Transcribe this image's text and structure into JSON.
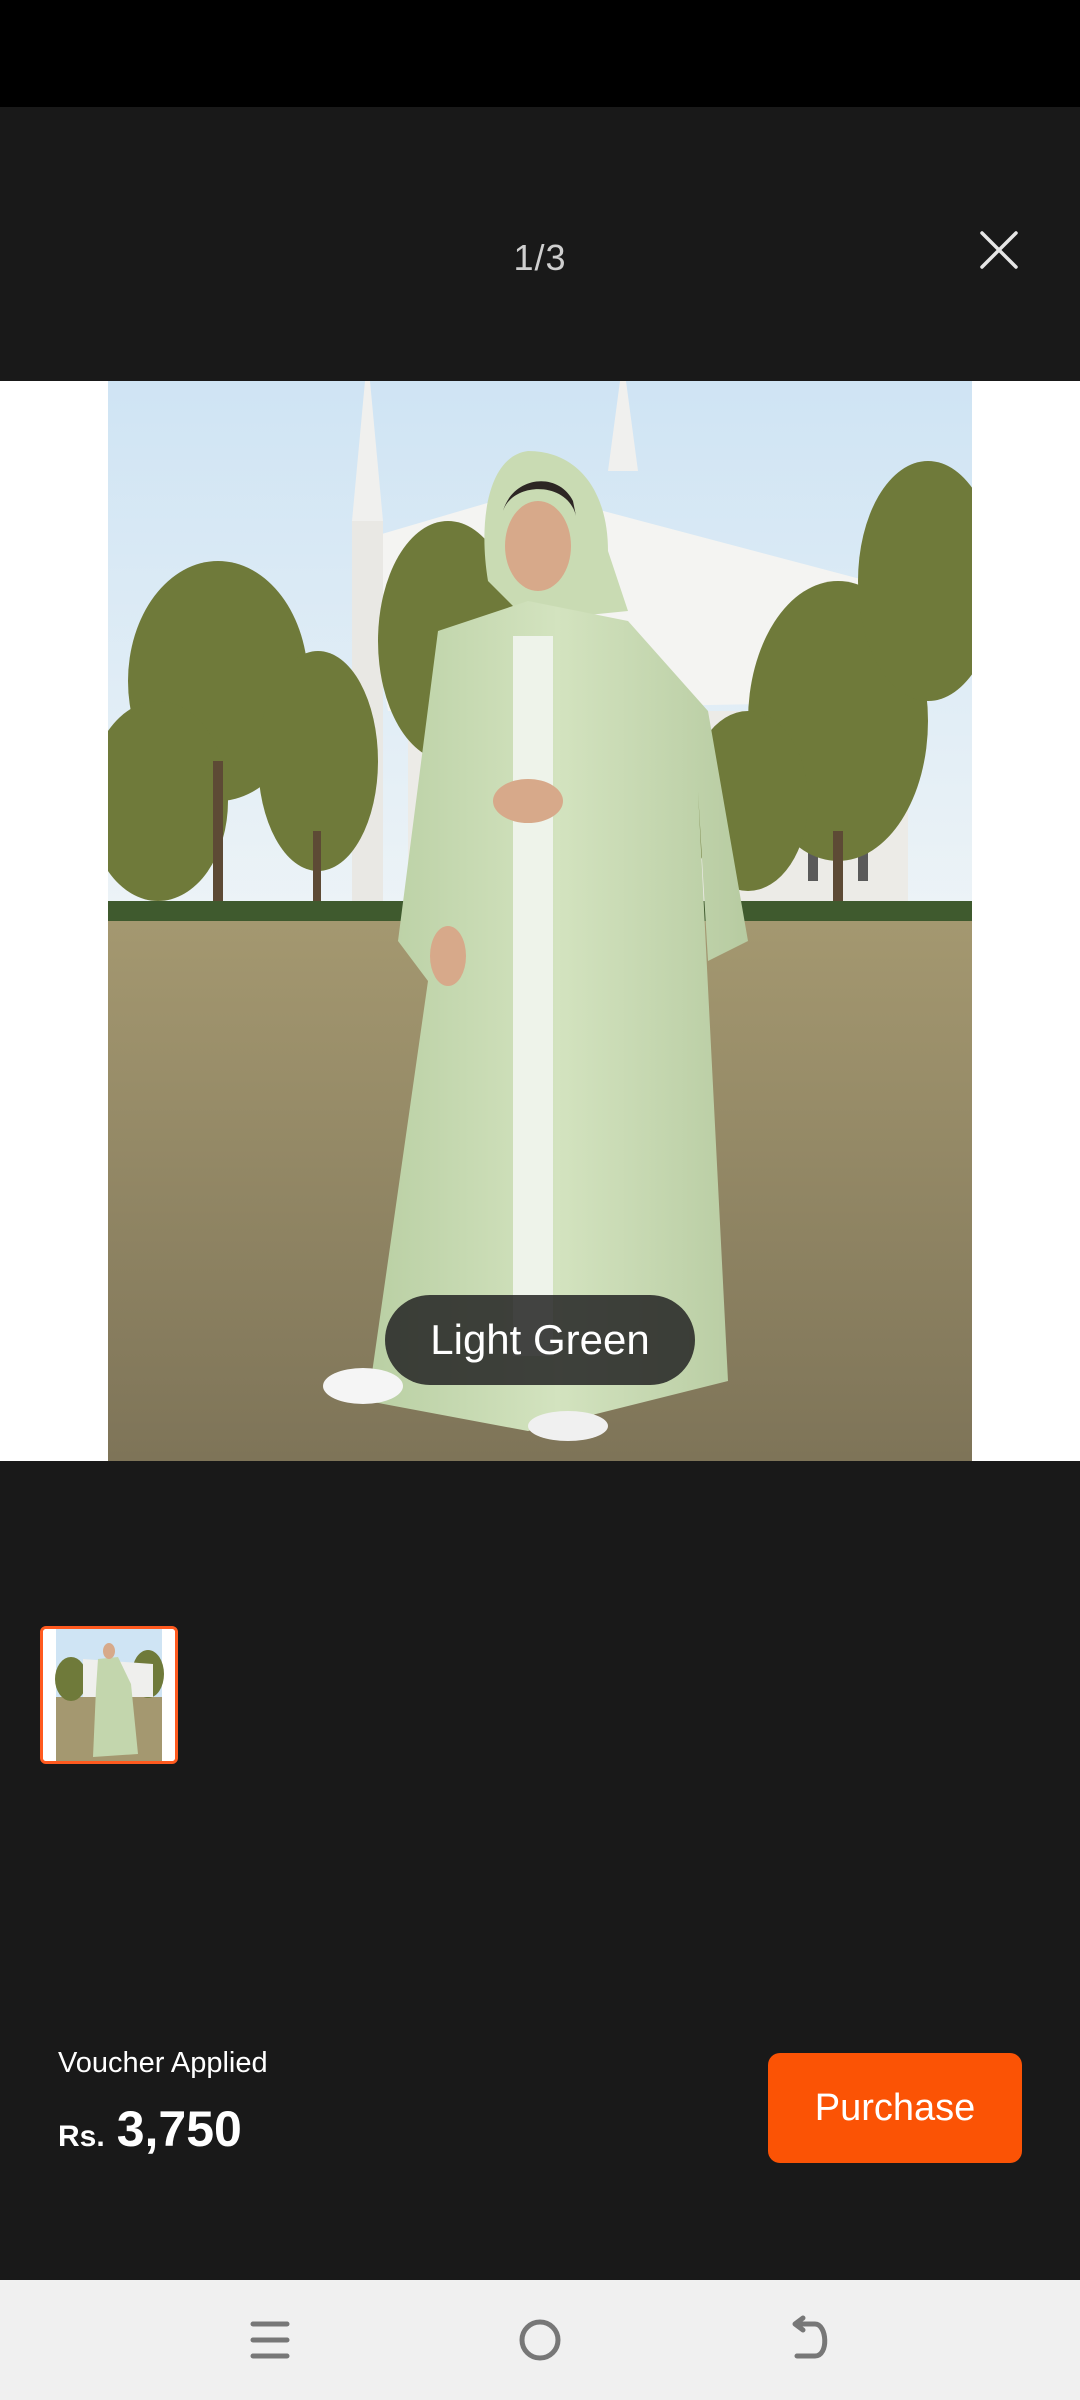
{
  "viewer": {
    "page_counter": "1/3",
    "close_icon": "close-icon"
  },
  "image": {
    "variant_label": "Light Green",
    "subject": "woman-in-light-green-abaya"
  },
  "thumbnails": [
    {
      "selected": true,
      "accent": "#ff5a1f"
    }
  ],
  "footer": {
    "voucher_label": "Voucher Applied",
    "currency": "Rs.",
    "price": "3,750",
    "purchase_label": "Purchase",
    "purchase_color": "#fb5305"
  },
  "navigation": {
    "menu_icon": "menu-icon",
    "home_icon": "home-icon",
    "back_icon": "back-icon"
  }
}
